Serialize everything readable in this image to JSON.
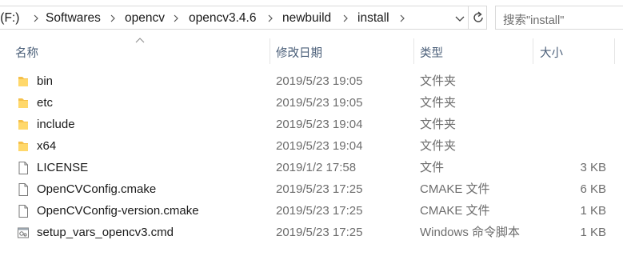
{
  "address_bar": {
    "crumbs": [
      " (F:)",
      "Softwares",
      "opencv",
      "opencv3.4.6",
      "newbuild",
      "install"
    ],
    "cut_prefix": " "
  },
  "search": {
    "placeholder": "搜索\"install\""
  },
  "columns": {
    "name": "名称",
    "date": "修改日期",
    "type": "类型",
    "size": "大小"
  },
  "files": [
    {
      "name": "bin",
      "date": "2019/5/23 19:05",
      "type": "文件夹",
      "size": "",
      "icon": "folder-icon"
    },
    {
      "name": "etc",
      "date": "2019/5/23 19:05",
      "type": "文件夹",
      "size": "",
      "icon": "folder-icon"
    },
    {
      "name": "include",
      "date": "2019/5/23 19:04",
      "type": "文件夹",
      "size": "",
      "icon": "folder-icon"
    },
    {
      "name": "x64",
      "date": "2019/5/23 19:04",
      "type": "文件夹",
      "size": "",
      "icon": "folder-icon"
    },
    {
      "name": "LICENSE",
      "date": "2019/1/2 17:58",
      "type": "文件",
      "size": "3 KB",
      "icon": "file-icon"
    },
    {
      "name": "OpenCVConfig.cmake",
      "date": "2019/5/23 17:25",
      "type": "CMAKE 文件",
      "size": "6 KB",
      "icon": "file-icon"
    },
    {
      "name": "OpenCVConfig-version.cmake",
      "date": "2019/5/23 17:25",
      "type": "CMAKE 文件",
      "size": "1 KB",
      "icon": "file-icon"
    },
    {
      "name": "setup_vars_opencv3.cmd",
      "date": "2019/5/23 17:25",
      "type": "Windows 命令脚本",
      "size": "1 KB",
      "icon": "cmd-script-icon"
    }
  ],
  "colors": {
    "folder": "#f5c04a",
    "header_text": "#4c607a",
    "secondary_text": "#6d6d6d"
  }
}
